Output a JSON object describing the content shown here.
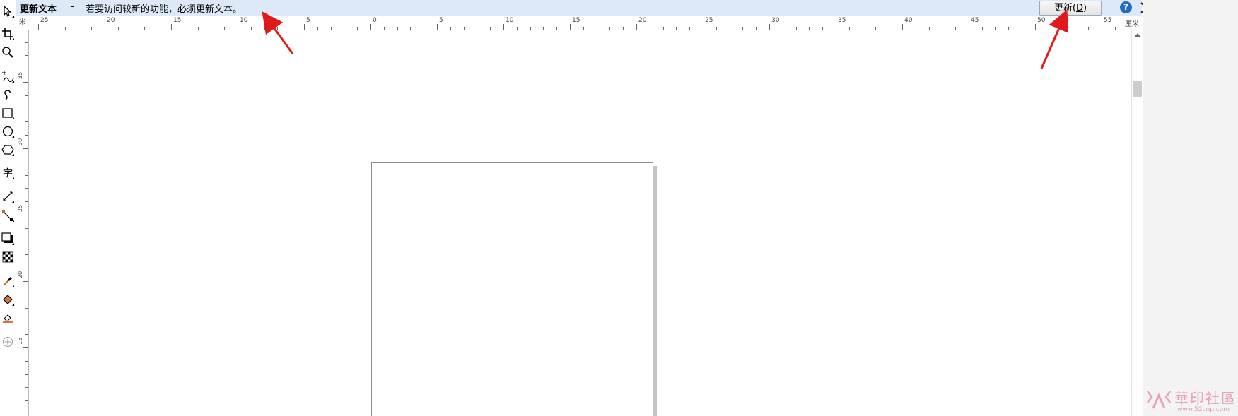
{
  "notification": {
    "title": "更新文本",
    "dash": "-",
    "message": "若要访问较新的功能，必须更新文本。",
    "update_button_label": "更新(D)",
    "update_button_main": "更新(",
    "update_button_mnemonic": "D",
    "update_button_end": ")",
    "help_icon_glyph": "?"
  },
  "ruler": {
    "corner_label": "米",
    "units_label": "厘米",
    "h_labels": [
      "25",
      "20",
      "15",
      "10",
      "5",
      "0",
      "5",
      "10",
      "15",
      "20",
      "25",
      "30",
      "35",
      "40",
      "45",
      "50",
      "55"
    ],
    "v_labels": [
      "35",
      "30",
      "25",
      "20",
      "15"
    ]
  },
  "toolbox": {
    "tools": [
      "pick-tool-icon",
      "crop-tool-icon",
      "zoom-tool-icon",
      "freehand-tool-icon",
      "artistic-media-icon",
      "rectangle-tool-icon",
      "ellipse-tool-icon",
      "polygon-tool-icon",
      "text-tool-icon",
      "parallel-dimension-icon",
      "connector-tool-icon",
      "drop-shadow-icon",
      "transparency-tool-icon",
      "eyedropper-tool-icon",
      "interactive-fill-icon",
      "smart-fill-icon",
      "add-tool-icon"
    ],
    "text_tool_glyph": "字"
  },
  "watermark": {
    "text": "華印社區",
    "url": "www.52cnp.com"
  },
  "colors": {
    "notify_bg": "#dde9f7",
    "help_blue": "#1f6cc6",
    "arrow_red": "#e01a1a"
  }
}
